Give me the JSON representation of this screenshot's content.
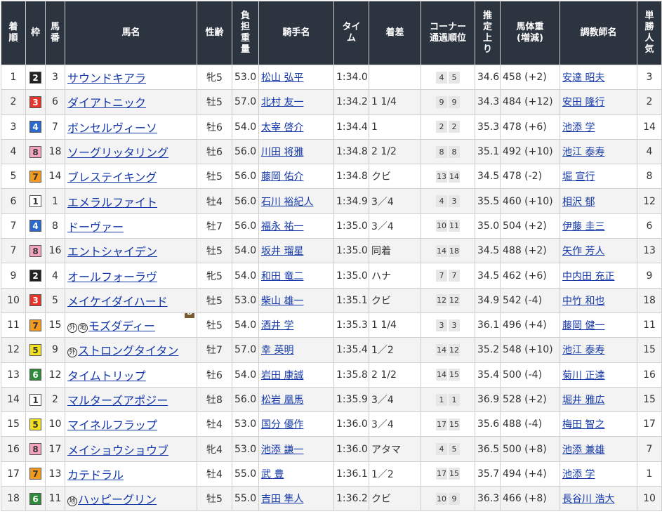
{
  "headers": {
    "rank": [
      "着",
      "順"
    ],
    "waku": "枠",
    "umaban": [
      "馬",
      "番"
    ],
    "horse": "馬名",
    "sexage": "性齢",
    "weight": [
      "負",
      "担",
      "重",
      "量"
    ],
    "jockey": "騎手名",
    "time": [
      "タ",
      "イ",
      "ム"
    ],
    "margin": "着差",
    "corner": [
      "コーナー",
      "通過順位"
    ],
    "last3f": [
      "推",
      "定",
      "上",
      "り"
    ],
    "body": [
      "馬体重",
      "(増減)"
    ],
    "trainer": "調教師名",
    "pop": [
      "単",
      "勝",
      "人",
      "気"
    ]
  },
  "waku_colors": {
    "1": {
      "bg": "#ffffff",
      "fg": "#333333"
    },
    "2": {
      "bg": "#222222",
      "fg": "#ffffff"
    },
    "3": {
      "bg": "#e8332b",
      "fg": "#ffffff"
    },
    "4": {
      "bg": "#2a6ad0",
      "fg": "#ffffff"
    },
    "5": {
      "bg": "#f2e21e",
      "fg": "#333333"
    },
    "6": {
      "bg": "#2e8b3a",
      "fg": "#ffffff"
    },
    "7": {
      "bg": "#f39a1e",
      "fg": "#333333"
    },
    "8": {
      "bg": "#f4a3bd",
      "fg": "#333333"
    }
  },
  "rows": [
    {
      "rank": "1",
      "waku": "2",
      "umaban": "3",
      "marks": [],
      "horse": "サウンドキアラ",
      "blinker": "",
      "sexage": "牝5",
      "weight": "53.0",
      "jockey": "松山 弘平",
      "time": "1:34.0",
      "margin": "",
      "corner": [
        "4",
        "5"
      ],
      "last3f": "34.6",
      "body": "458 (+2)",
      "trainer": "安達 昭夫",
      "pop": "3"
    },
    {
      "rank": "2",
      "waku": "3",
      "umaban": "6",
      "marks": [],
      "horse": "ダイアトニック",
      "blinker": "",
      "sexage": "牡5",
      "weight": "57.0",
      "jockey": "北村 友一",
      "time": "1:34.2",
      "margin": "1 1/4",
      "corner": [
        "9",
        "9"
      ],
      "last3f": "34.3",
      "body": "484 (+12)",
      "trainer": "安田 隆行",
      "pop": "2"
    },
    {
      "rank": "3",
      "waku": "4",
      "umaban": "7",
      "marks": [],
      "horse": "ボンセルヴィーソ",
      "blinker": "",
      "sexage": "牡6",
      "weight": "54.0",
      "jockey": "太宰 啓介",
      "time": "1:34.4",
      "margin": "1",
      "corner": [
        "2",
        "2"
      ],
      "last3f": "35.3",
      "body": "478 (+6)",
      "trainer": "池添 学",
      "pop": "14"
    },
    {
      "rank": "4",
      "waku": "8",
      "umaban": "18",
      "marks": [],
      "horse": "ソーグリッタリング",
      "blinker": "",
      "sexage": "牡6",
      "weight": "56.0",
      "jockey": "川田 将雅",
      "time": "1:34.8",
      "margin": "2 1/2",
      "corner": [
        "8",
        "8"
      ],
      "last3f": "35.1",
      "body": "492 (+10)",
      "trainer": "池江 泰寿",
      "pop": "4"
    },
    {
      "rank": "5",
      "waku": "7",
      "umaban": "14",
      "marks": [],
      "horse": "ブレステイキング",
      "blinker": "",
      "sexage": "牡5",
      "weight": "56.0",
      "jockey": "藤岡 佑介",
      "time": "1:34.8",
      "margin": "クビ",
      "corner": [
        "13",
        "14"
      ],
      "last3f": "34.5",
      "body": "478 (-2)",
      "trainer": "堀 宣行",
      "pop": "8"
    },
    {
      "rank": "6",
      "waku": "1",
      "umaban": "1",
      "marks": [],
      "horse": "エメラルファイト",
      "blinker": "",
      "sexage": "牡4",
      "weight": "56.0",
      "jockey": "石川 裕紀人",
      "time": "1:34.9",
      "margin": "3／4",
      "corner": [
        "4",
        "3"
      ],
      "last3f": "35.5",
      "body": "460 (+10)",
      "trainer": "相沢 郁",
      "pop": "12"
    },
    {
      "rank": "7",
      "waku": "4",
      "umaban": "8",
      "marks": [],
      "horse": "ドーヴァー",
      "blinker": "",
      "sexage": "牡7",
      "weight": "56.0",
      "jockey": "福永 祐一",
      "time": "1:35.0",
      "margin": "3／4",
      "corner": [
        "10",
        "11"
      ],
      "last3f": "35.0",
      "body": "504 (+2)",
      "trainer": "伊藤 圭三",
      "pop": "6"
    },
    {
      "rank": "7",
      "waku": "8",
      "umaban": "16",
      "marks": [],
      "horse": "エントシャイデン",
      "blinker": "",
      "sexage": "牡5",
      "weight": "54.0",
      "jockey": "坂井 瑠星",
      "time": "1:35.0",
      "margin": "同着",
      "corner": [
        "14",
        "18"
      ],
      "last3f": "34.5",
      "body": "488 (+2)",
      "trainer": "矢作 芳人",
      "pop": "13"
    },
    {
      "rank": "9",
      "waku": "2",
      "umaban": "4",
      "marks": [],
      "horse": "オールフォーラヴ",
      "blinker": "",
      "sexage": "牝5",
      "weight": "54.0",
      "jockey": "和田 竜二",
      "time": "1:35.0",
      "margin": "ハナ",
      "corner": [
        "7",
        "7"
      ],
      "last3f": "34.5",
      "body": "462 (+6)",
      "trainer": "中内田 充正",
      "pop": "9"
    },
    {
      "rank": "10",
      "waku": "3",
      "umaban": "5",
      "marks": [],
      "horse": "メイケイダイハード",
      "blinker": "",
      "sexage": "牡5",
      "weight": "53.0",
      "jockey": "柴山 雄一",
      "time": "1:35.1",
      "margin": "クビ",
      "corner": [
        "12",
        "12"
      ],
      "last3f": "34.9",
      "body": "542 (-4)",
      "trainer": "中竹 和也",
      "pop": "18"
    },
    {
      "rank": "11",
      "waku": "7",
      "umaban": "15",
      "marks": [
        "外",
        "地"
      ],
      "horse": "モズダディー",
      "blinker": "B",
      "sexage": "牡5",
      "weight": "54.0",
      "jockey": "酒井 学",
      "time": "1:35.3",
      "margin": "1 1/4",
      "corner": [
        "3",
        "3"
      ],
      "last3f": "36.1",
      "body": "496 (+4)",
      "trainer": "藤岡 健一",
      "pop": "11"
    },
    {
      "rank": "12",
      "waku": "5",
      "umaban": "9",
      "marks": [
        "外"
      ],
      "horse": "ストロングタイタン",
      "blinker": "",
      "sexage": "牡7",
      "weight": "57.0",
      "jockey": "幸 英明",
      "time": "1:35.4",
      "margin": "1／2",
      "corner": [
        "14",
        "12"
      ],
      "last3f": "35.2",
      "body": "548 (+10)",
      "trainer": "池江 泰寿",
      "pop": "15"
    },
    {
      "rank": "13",
      "waku": "6",
      "umaban": "12",
      "marks": [],
      "horse": "タイムトリップ",
      "blinker": "",
      "sexage": "牡6",
      "weight": "54.0",
      "jockey": "岩田 康誠",
      "time": "1:35.8",
      "margin": "2 1/2",
      "corner": [
        "14",
        "15"
      ],
      "last3f": "35.4",
      "body": "500 (-4)",
      "trainer": "菊川 正達",
      "pop": "16"
    },
    {
      "rank": "14",
      "waku": "1",
      "umaban": "2",
      "marks": [],
      "horse": "マルターズアポジー",
      "blinker": "",
      "sexage": "牡8",
      "weight": "56.0",
      "jockey": "松岩 凰馬",
      "time": "1:35.9",
      "margin": "3／4",
      "corner": [
        "1",
        "1"
      ],
      "last3f": "36.9",
      "body": "528 (+2)",
      "trainer": "堀井 雅広",
      "pop": "15"
    },
    {
      "rank": "15",
      "waku": "5",
      "umaban": "10",
      "marks": [],
      "horse": "マイネルフラップ",
      "blinker": "",
      "sexage": "牡4",
      "weight": "53.0",
      "jockey": "国分 優作",
      "time": "1:36.0",
      "margin": "3／4",
      "corner": [
        "17",
        "15"
      ],
      "last3f": "35.6",
      "body": "488 (-4)",
      "trainer": "梅田 智之",
      "pop": "17"
    },
    {
      "rank": "16",
      "waku": "8",
      "umaban": "17",
      "marks": [],
      "horse": "メイショウショウブ",
      "blinker": "",
      "sexage": "牝4",
      "weight": "53.0",
      "jockey": "池添 謙一",
      "time": "1:36.0",
      "margin": "アタマ",
      "corner": [
        "4",
        "5"
      ],
      "last3f": "36.5",
      "body": "500 (+8)",
      "trainer": "池添 兼雄",
      "pop": "7"
    },
    {
      "rank": "17",
      "waku": "7",
      "umaban": "13",
      "marks": [],
      "horse": "カテドラル",
      "blinker": "",
      "sexage": "牡4",
      "weight": "55.0",
      "jockey": "武 豊",
      "time": "1:36.1",
      "margin": "1／2",
      "corner": [
        "17",
        "15"
      ],
      "last3f": "35.7",
      "body": "494 (+4)",
      "trainer": "池添 学",
      "pop": "1"
    },
    {
      "rank": "18",
      "waku": "6",
      "umaban": "11",
      "marks": [
        "地"
      ],
      "horse": "ハッピーグリン",
      "blinker": "",
      "sexage": "牡5",
      "weight": "55.0",
      "jockey": "吉田 隼人",
      "time": "1:36.2",
      "margin": "クビ",
      "corner": [
        "10",
        "9"
      ],
      "last3f": "36.3",
      "body": "466 (+8)",
      "trainer": "長谷川 浩大",
      "pop": "10"
    }
  ]
}
